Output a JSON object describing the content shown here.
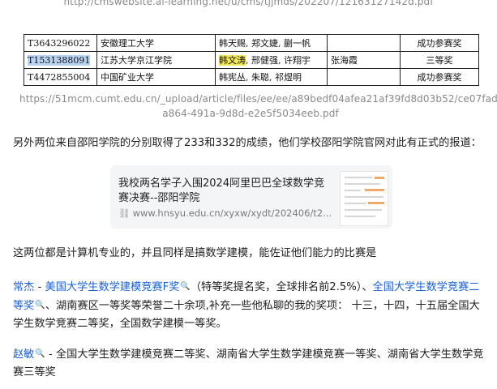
{
  "top_url": "http://cmswebsite.ai-learning.net/u/cms/tjjmds/202207/12163127142d.pdf",
  "table": {
    "rows": [
      {
        "id": "T3643296022",
        "school": "安徽理工大学",
        "members": "韩天赐, 郑文婕, 蒯一帆",
        "advisor": "",
        "award": "成功参赛奖"
      },
      {
        "id": "T1531388091",
        "school": "江苏大学京江学院",
        "member_hl": "韩文涛",
        "members_rest": ", 邢健强, 许翔宇",
        "advisor": "张海霞",
        "award": "三等奖"
      },
      {
        "id": "T4472855004",
        "school": "中国矿业大学",
        "members": "韩宪丛, 朱聪, 祁煜明",
        "advisor": "",
        "award": "成功参赛奖"
      }
    ]
  },
  "pdf_url": "https://51mcm.cumt.edu.cn/_upload/article/files/ee/ee/a89bedf04afea21af39fd8d03b52/ce07fad-a864-491a-9d8d-e2e5f5034eeb.pdf",
  "p1": "另外两位来自邵阳学院的分别取得了233和332的成绩，他们学校邵阳学院官网对此有正式的报道：",
  "card": {
    "title": "我校两名学子入围2024阿里巴巴全球数学竞赛决赛--邵阳学院",
    "url": "www.hnsyu.edu.cn/xyxw/xydt/202406/t2...",
    "link_icon": "⛓"
  },
  "p2": "这两位都是计算机专业的，并且同样是搞数学建模，能佐证他们能力的比赛是",
  "p3": {
    "name": "常杰",
    "sep": " - ",
    "award1": "美国大学生数学建模竞赛F奖",
    "search_icon": "🔍",
    "note": "（特等奖提名奖，全球排名前2.5%）、",
    "award2": "全国大学生数学竞赛二等奖",
    "rest": "、湖南赛区一等奖等荣誉二十余项,补充一些他私聊的我的奖项：  十三，十四，十五届全国大学生数学竞赛二等奖，全国数学建模一等奖。"
  },
  "p4": {
    "name": "赵敏",
    "sep": " - ",
    "text": "全国大学生数学建模竞赛二等奖、湖南省大学生数学建模竞赛一等奖、湖南省大学生数学竞赛三等奖"
  }
}
